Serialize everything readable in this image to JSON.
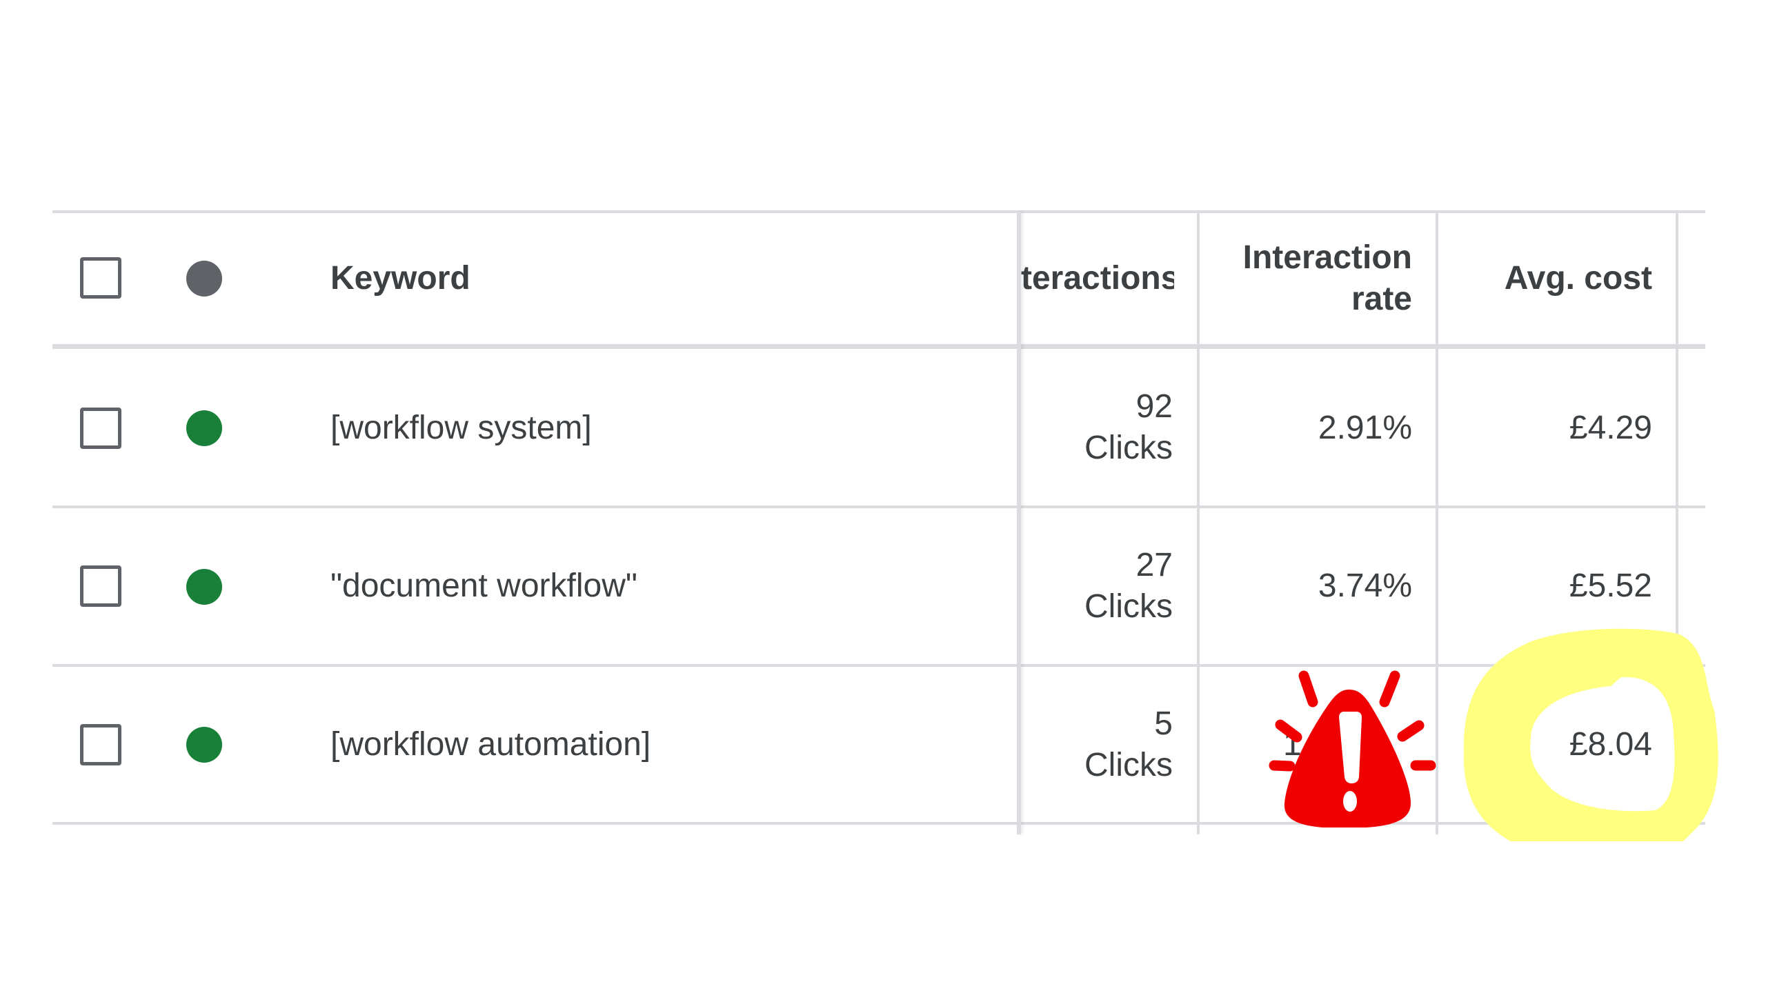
{
  "table": {
    "headers": {
      "keyword": "Keyword",
      "interactions": "teractions",
      "interaction_rate_line1": "Interaction",
      "interaction_rate_line2": "rate",
      "avg_cost": "Avg. cost"
    },
    "rows": [
      {
        "keyword": "[workflow system]",
        "interactions": "92",
        "interactions_unit": "Clicks",
        "interaction_rate": "2.91%",
        "avg_cost": "£4.29",
        "status": "enabled"
      },
      {
        "keyword": "\"document workflow\"",
        "interactions": "27",
        "interactions_unit": "Clicks",
        "interaction_rate": "3.74%",
        "avg_cost": "£5.52",
        "status": "enabled"
      },
      {
        "keyword": "[workflow automation]",
        "interactions": "5",
        "interactions_unit": "Clicks",
        "interaction_rate": "1",
        "avg_cost": "£8.04",
        "status": "enabled"
      }
    ]
  },
  "annotations": {
    "warning_icon": "alert-warning-icon",
    "highlight": "yellow-circle-highlight"
  },
  "colors": {
    "status_enabled": "#188038",
    "status_header": "#5f6368",
    "warning": "#f00000",
    "highlight": "#ffff80"
  }
}
